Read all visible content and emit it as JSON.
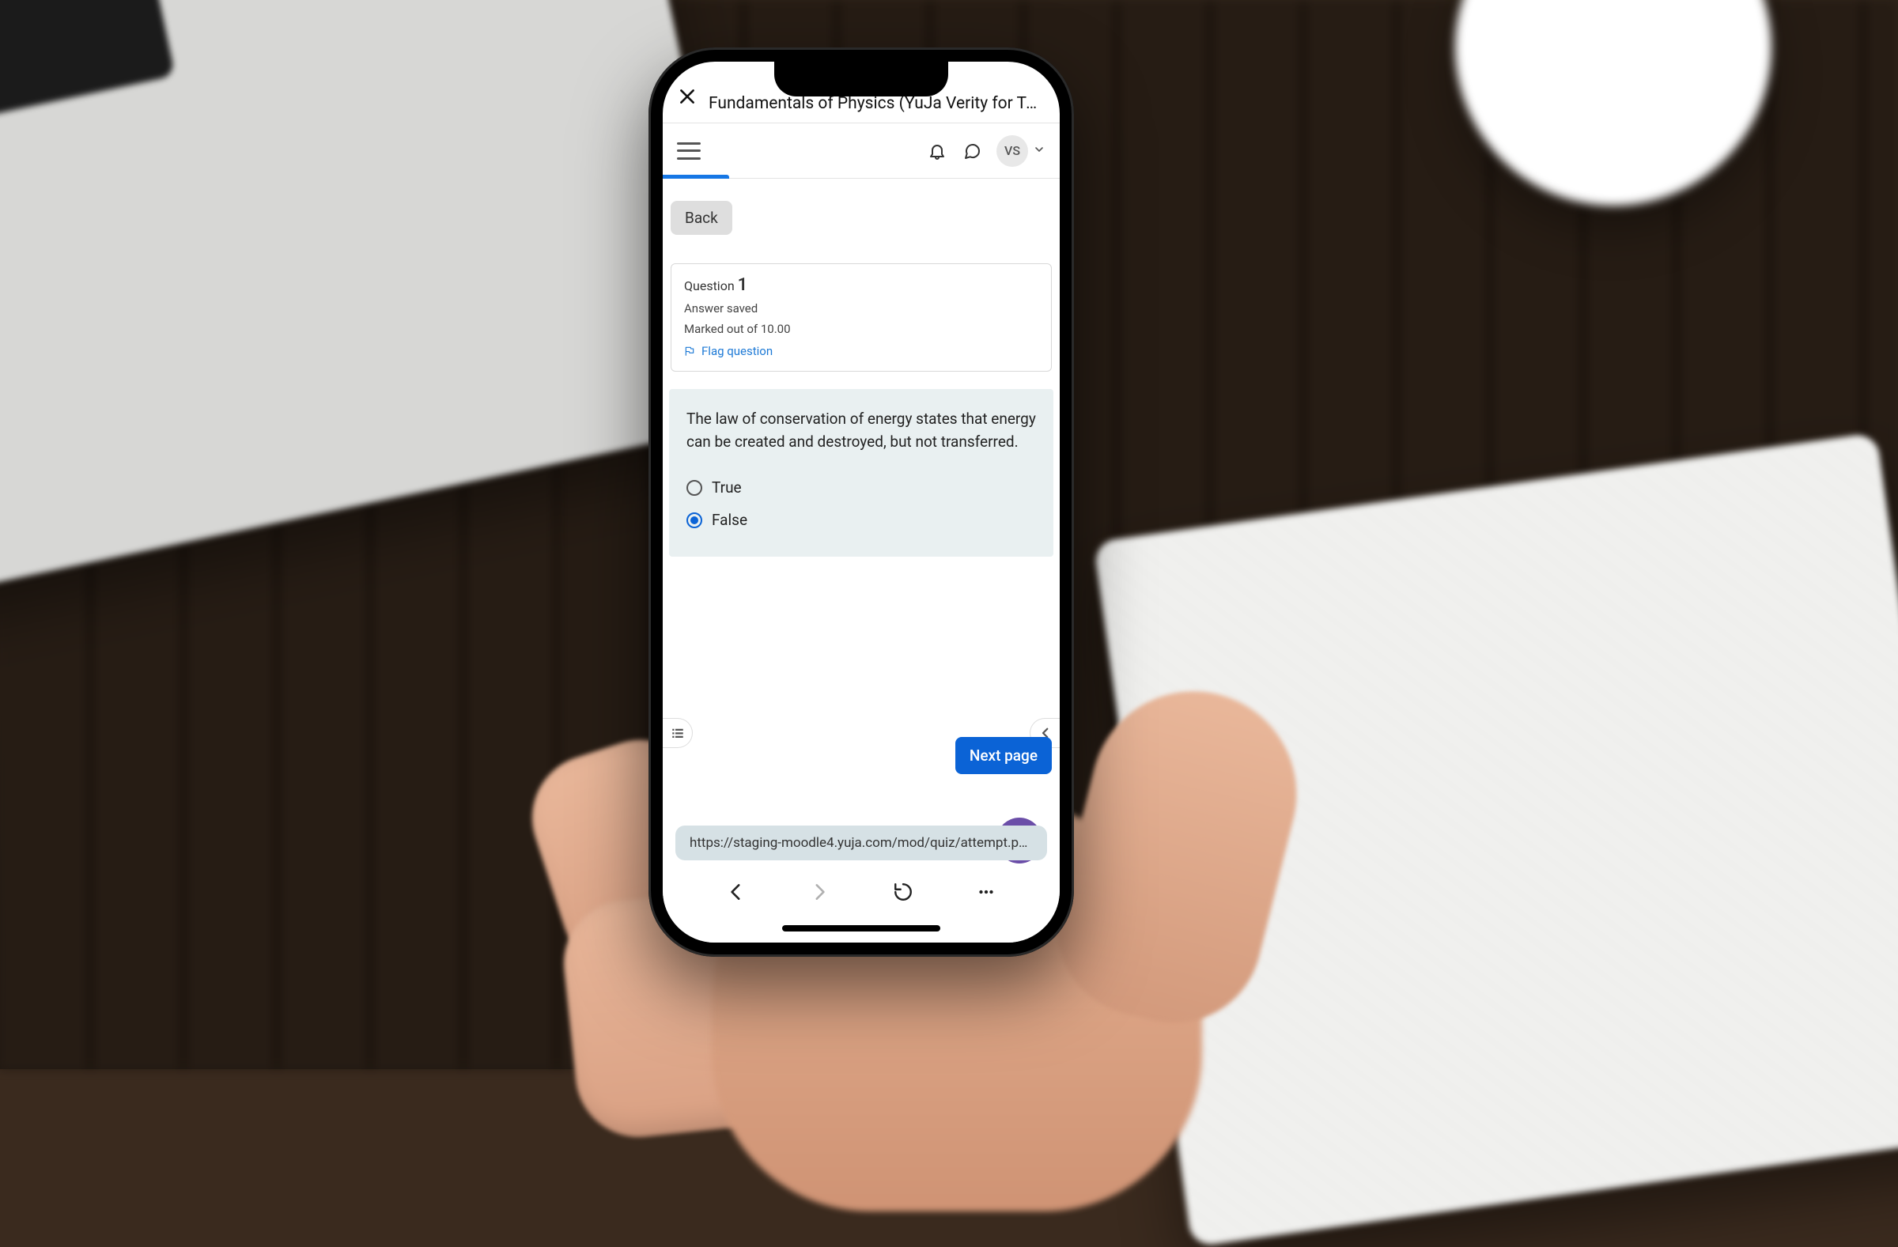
{
  "titlebar": {
    "title": "Fundamentals of Physics (YuJa Verity for Te…"
  },
  "header": {
    "avatar_initials": "VS"
  },
  "content": {
    "back_label": "Back",
    "question_card": {
      "label": "Question",
      "number": "1",
      "status": "Answer saved",
      "marks": "Marked out of 10.00",
      "flag_label": "Flag question"
    },
    "question_text": "The law of conservation of energy states that energy can be created and destroyed, but not transferred.",
    "options": [
      {
        "label": "True",
        "checked": false
      },
      {
        "label": "False",
        "checked": true
      }
    ],
    "next_label": "Next page"
  },
  "browser": {
    "url": "https://staging-moodle4.yuja.com/mod/quiz/attempt.php?…"
  }
}
